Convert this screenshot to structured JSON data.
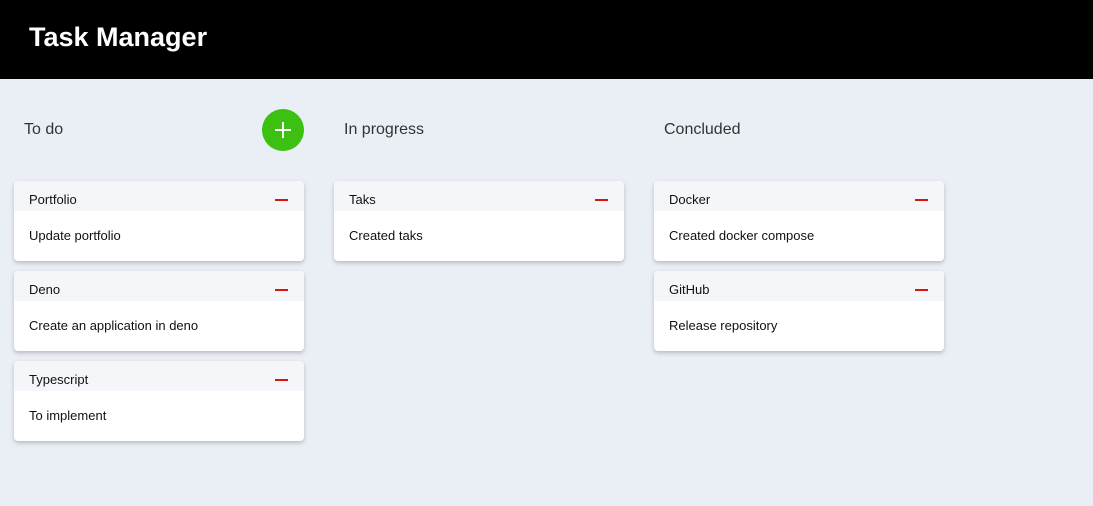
{
  "app": {
    "title": "Task Manager"
  },
  "colors": {
    "header_bg": "#000000",
    "board_bg": "#eaeff5",
    "add_button": "#3cc012",
    "remove_icon": "#d8140e"
  },
  "columns": [
    {
      "title": "To do",
      "has_add_button": true,
      "add_icon": "plus-icon",
      "cards": [
        {
          "title": "Portfolio",
          "description": "Update portfolio",
          "remove_icon": "minus-icon"
        },
        {
          "title": "Deno",
          "description": "Create an application in deno",
          "remove_icon": "minus-icon"
        },
        {
          "title": "Typescript",
          "description": "To implement",
          "remove_icon": "minus-icon"
        }
      ]
    },
    {
      "title": "In progress",
      "has_add_button": false,
      "cards": [
        {
          "title": "Taks",
          "description": "Created taks",
          "remove_icon": "minus-icon"
        }
      ]
    },
    {
      "title": "Concluded",
      "has_add_button": false,
      "cards": [
        {
          "title": "Docker",
          "description": "Created docker compose",
          "remove_icon": "minus-icon"
        },
        {
          "title": "GitHub",
          "description": "Release repository",
          "remove_icon": "minus-icon"
        }
      ]
    }
  ]
}
